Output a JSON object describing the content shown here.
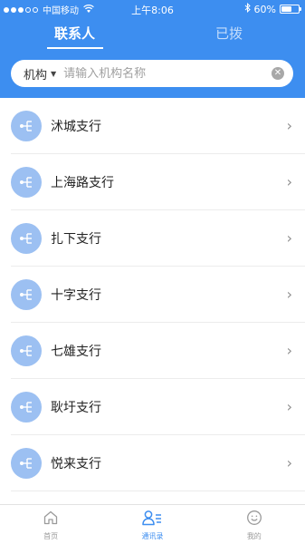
{
  "status_bar": {
    "carrier": "中国移动",
    "time": "上午8:06",
    "battery": "60%",
    "battery_level": 0.6
  },
  "tabs": [
    {
      "label": "联系人",
      "active": true
    },
    {
      "label": "已拨",
      "active": false
    }
  ],
  "search": {
    "filter_label": "机构",
    "placeholder": "请输入机构名称",
    "value": ""
  },
  "branches": [
    "沭城支行",
    "上海路支行",
    "扎下支行",
    "十字支行",
    "七雄支行",
    "耿圩支行",
    "悦来支行"
  ],
  "bottom_nav": [
    {
      "label": "首页",
      "icon": "home-icon",
      "active": false
    },
    {
      "label": "通讯录",
      "icon": "contacts-icon",
      "active": true
    },
    {
      "label": "我的",
      "icon": "profile-icon",
      "active": false
    }
  ],
  "colors": {
    "accent": "#3d8ef0",
    "org_icon_bg": "#9cc0f2",
    "inactive": "#9a9a9a"
  }
}
